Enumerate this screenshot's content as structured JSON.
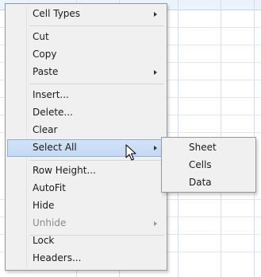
{
  "context_menu": {
    "items": [
      {
        "label": "Cell Types",
        "submenu": true,
        "disabled": false
      },
      {
        "label": "Cut",
        "submenu": false,
        "disabled": false
      },
      {
        "label": "Copy",
        "submenu": false,
        "disabled": false
      },
      {
        "label": "Paste",
        "submenu": true,
        "disabled": false
      },
      {
        "label": "Insert...",
        "submenu": false,
        "disabled": false
      },
      {
        "label": "Delete...",
        "submenu": false,
        "disabled": false
      },
      {
        "label": "Clear",
        "submenu": false,
        "disabled": false
      },
      {
        "label": "Select All",
        "submenu": true,
        "disabled": false,
        "highlighted": true
      },
      {
        "label": "Row Height...",
        "submenu": false,
        "disabled": false
      },
      {
        "label": "AutoFit",
        "submenu": false,
        "disabled": false
      },
      {
        "label": "Hide",
        "submenu": false,
        "disabled": false
      },
      {
        "label": "Unhide",
        "submenu": true,
        "disabled": true
      },
      {
        "label": "Lock",
        "submenu": false,
        "disabled": false
      },
      {
        "label": "Headers...",
        "submenu": false,
        "disabled": false
      }
    ]
  },
  "select_all_submenu": {
    "items": [
      {
        "label": "Sheet"
      },
      {
        "label": "Cells"
      },
      {
        "label": "Data"
      }
    ]
  },
  "icons": {
    "submenu_arrow": "chevron-right-icon",
    "cursor": "mouse-pointer-icon"
  },
  "colors": {
    "highlight_top": "#d4e3f7",
    "highlight_bottom": "#c4d9f2",
    "highlight_border": "#8fb0d9",
    "menu_bg": "#f0f0f0",
    "disabled_text": "#8a8a8a"
  }
}
